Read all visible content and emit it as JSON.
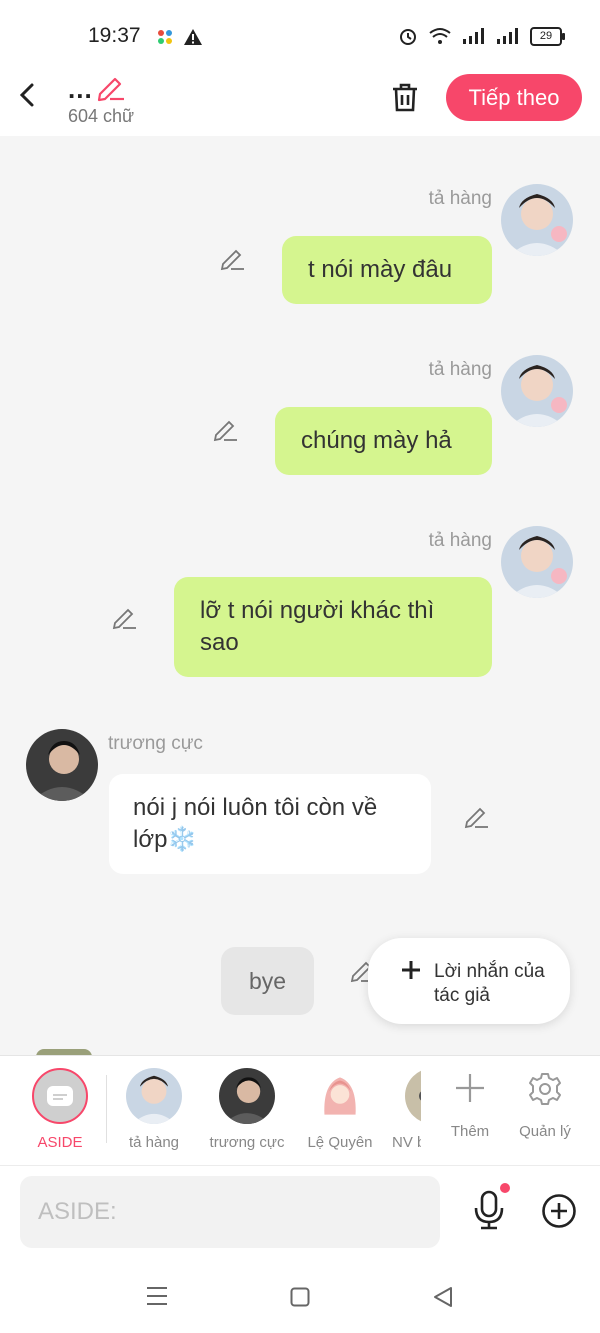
{
  "status": {
    "time": "19:37",
    "battery": "29"
  },
  "header": {
    "title": "...",
    "word_count": "604 chữ",
    "next_label": "Tiếp theo"
  },
  "messages": [
    {
      "sender": "tả hàng",
      "text": "t nói mày đâu"
    },
    {
      "sender": "tả hàng",
      "text": "chúng mày hả"
    },
    {
      "sender": "tả hàng",
      "text": "lỡ t nói người khác thì sao"
    },
    {
      "sender": "trương cực",
      "text": "nói j nói luôn tôi còn về lớp❄️"
    },
    {
      "sender": "",
      "text": "bye"
    }
  ],
  "popup": {
    "label": "Lời nhắn của tác giả"
  },
  "roles": {
    "aside": "ASIDE",
    "items": [
      "tả hàng",
      "trương cực",
      "Lệ Quyên",
      "NV b"
    ],
    "add": "Thêm",
    "manage": "Quản lý"
  },
  "input": {
    "placeholder": "ASIDE:"
  },
  "colors": {
    "accent": "#f7476a",
    "bubble_green": "#d5f58f",
    "bubble_white": "#ffffff"
  }
}
